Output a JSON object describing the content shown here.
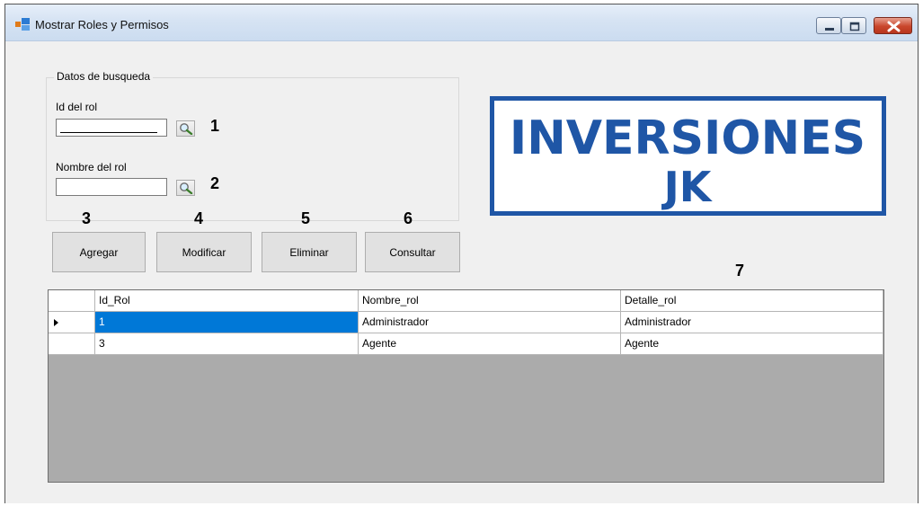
{
  "window": {
    "title": "Mostrar Roles y Permisos",
    "controls": [
      "minimize",
      "maximize",
      "close"
    ]
  },
  "search_group": {
    "legend": "Datos de busqueda",
    "id_label": "Id del rol",
    "id_value": "",
    "name_label": "Nombre del rol",
    "name_value": "",
    "id_marker": "1",
    "name_marker": "2"
  },
  "actions": [
    {
      "label": "Agregar",
      "marker": "3"
    },
    {
      "label": "Modificar",
      "marker": "4"
    },
    {
      "label": "Eliminar",
      "marker": "5"
    },
    {
      "label": "Consultar",
      "marker": "6"
    }
  ],
  "logo": {
    "line1": "INVERSIONES",
    "line2": "JK",
    "color": "#1f56a6"
  },
  "grid_marker": "7",
  "grid": {
    "columns": [
      "Id_Rol",
      "Nombre_rol",
      "Detalle_rol"
    ],
    "rows": [
      {
        "Id_Rol": "1",
        "Nombre_rol": "Administrador",
        "Detalle_rol": "Administrador",
        "selected": true
      },
      {
        "Id_Rol": "3",
        "Nombre_rol": "Agente",
        "Detalle_rol": "Agente",
        "selected": false
      }
    ]
  },
  "colors": {
    "selection": "#0078d7",
    "grid_background": "#ababab",
    "form_background": "#f0f0f0"
  }
}
